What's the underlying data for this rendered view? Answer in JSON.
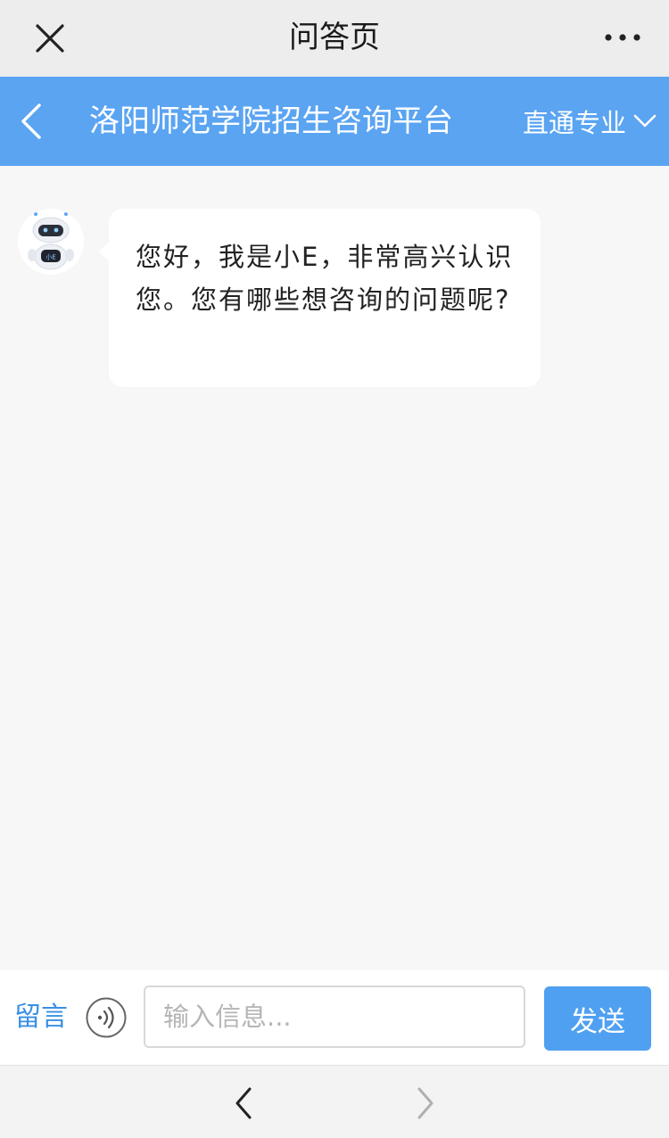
{
  "wechat_bar": {
    "title": "问答页",
    "close_icon": "close-icon",
    "more_icon": "more-dots-icon"
  },
  "header": {
    "back_icon": "chevron-left-icon",
    "title": "洛阳师范学院招生咨询平台",
    "major_select_label": "直通专业",
    "dropdown_icon": "chevron-down-icon",
    "background_color": "#5aa4f2"
  },
  "chat": {
    "messages": [
      {
        "sender": "bot",
        "avatar_icon": "robot-avatar-icon",
        "avatar_badge": "小E",
        "text": "您好，我是小E，非常高兴认识您。您有哪些想咨询的问题呢?"
      }
    ]
  },
  "input_bar": {
    "leave_message_label": "留言",
    "voice_icon": "voice-icon",
    "input_placeholder": "输入信息...",
    "input_value": "",
    "send_label": "发送",
    "send_color": "#4fa0f0"
  },
  "browser_nav": {
    "back_icon": "nav-back-icon",
    "forward_icon": "nav-forward-icon"
  }
}
